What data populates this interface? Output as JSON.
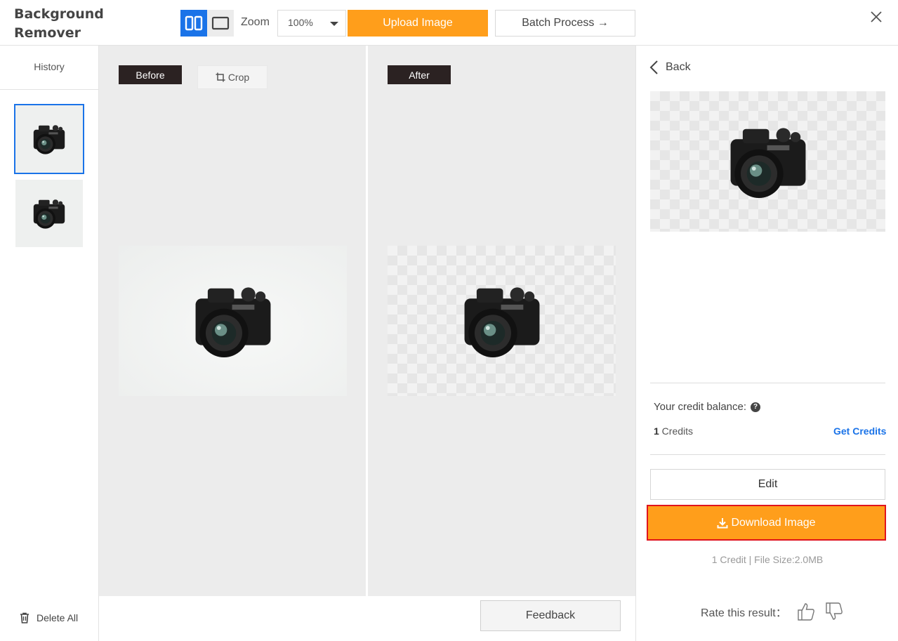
{
  "header": {
    "title": "Background Remover",
    "zoom_label": "Zoom",
    "zoom_value": "100%",
    "upload_label": "Upload Image",
    "batch_label": "Batch Process →"
  },
  "sidebar": {
    "history_label": "History",
    "delete_all_label": "Delete All"
  },
  "workspace": {
    "before_label": "Before",
    "crop_label": "Crop",
    "after_label": "After",
    "feedback_label": "Feedback"
  },
  "panel": {
    "back_label": "Back",
    "credit_balance_label": "Your credit balance:",
    "credits_count": "1",
    "credits_unit": " Credits",
    "get_credits_label": "Get Credits",
    "edit_label": "Edit",
    "download_label": "Download Image",
    "file_info": "1 Credit | File Size:2.0MB",
    "rate_label": "Rate this result："
  },
  "colors": {
    "accent_blue": "#1a73e8",
    "accent_orange": "#ff9e1b",
    "highlight_red": "#e0131c"
  }
}
